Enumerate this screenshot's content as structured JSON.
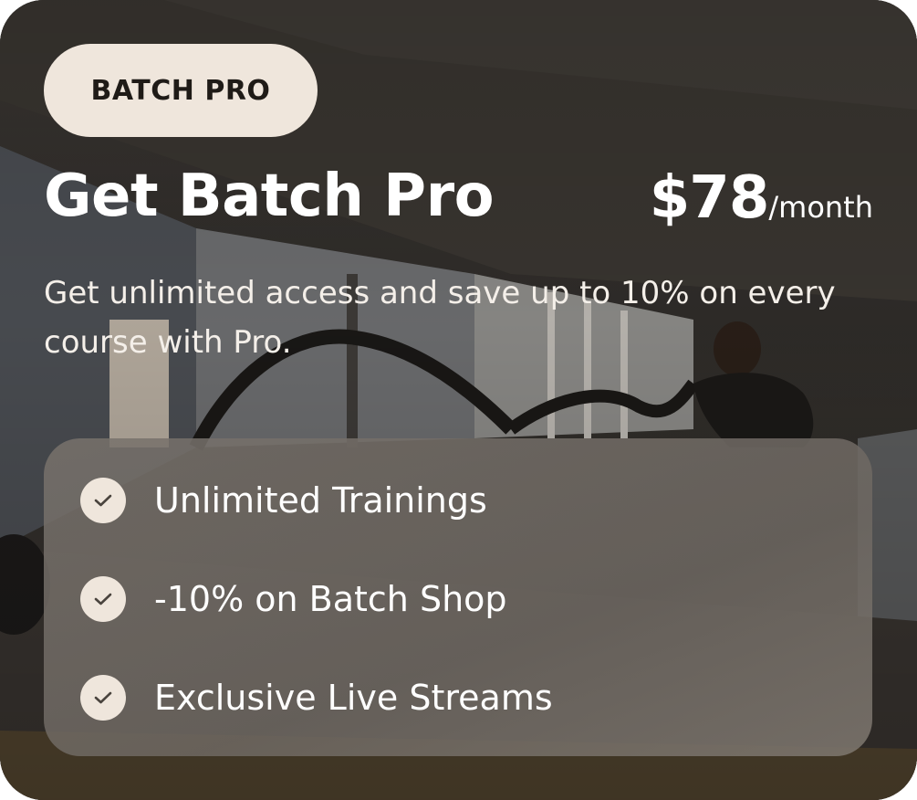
{
  "badge": {
    "label": "BATCH PRO"
  },
  "plan": {
    "title": "Get Batch Pro",
    "price": "$78",
    "period": "/month",
    "description": "Get unlimited access and save up to 10% on every course with Pro."
  },
  "features": [
    {
      "label": "Unlimited Trainings"
    },
    {
      "label": "-10% on Batch Shop"
    },
    {
      "label": "Exclusive Live Streams"
    }
  ],
  "colors": {
    "badge_bg": "#efe6dc",
    "text": "#ffffff",
    "check_icon": "#4a443e"
  }
}
